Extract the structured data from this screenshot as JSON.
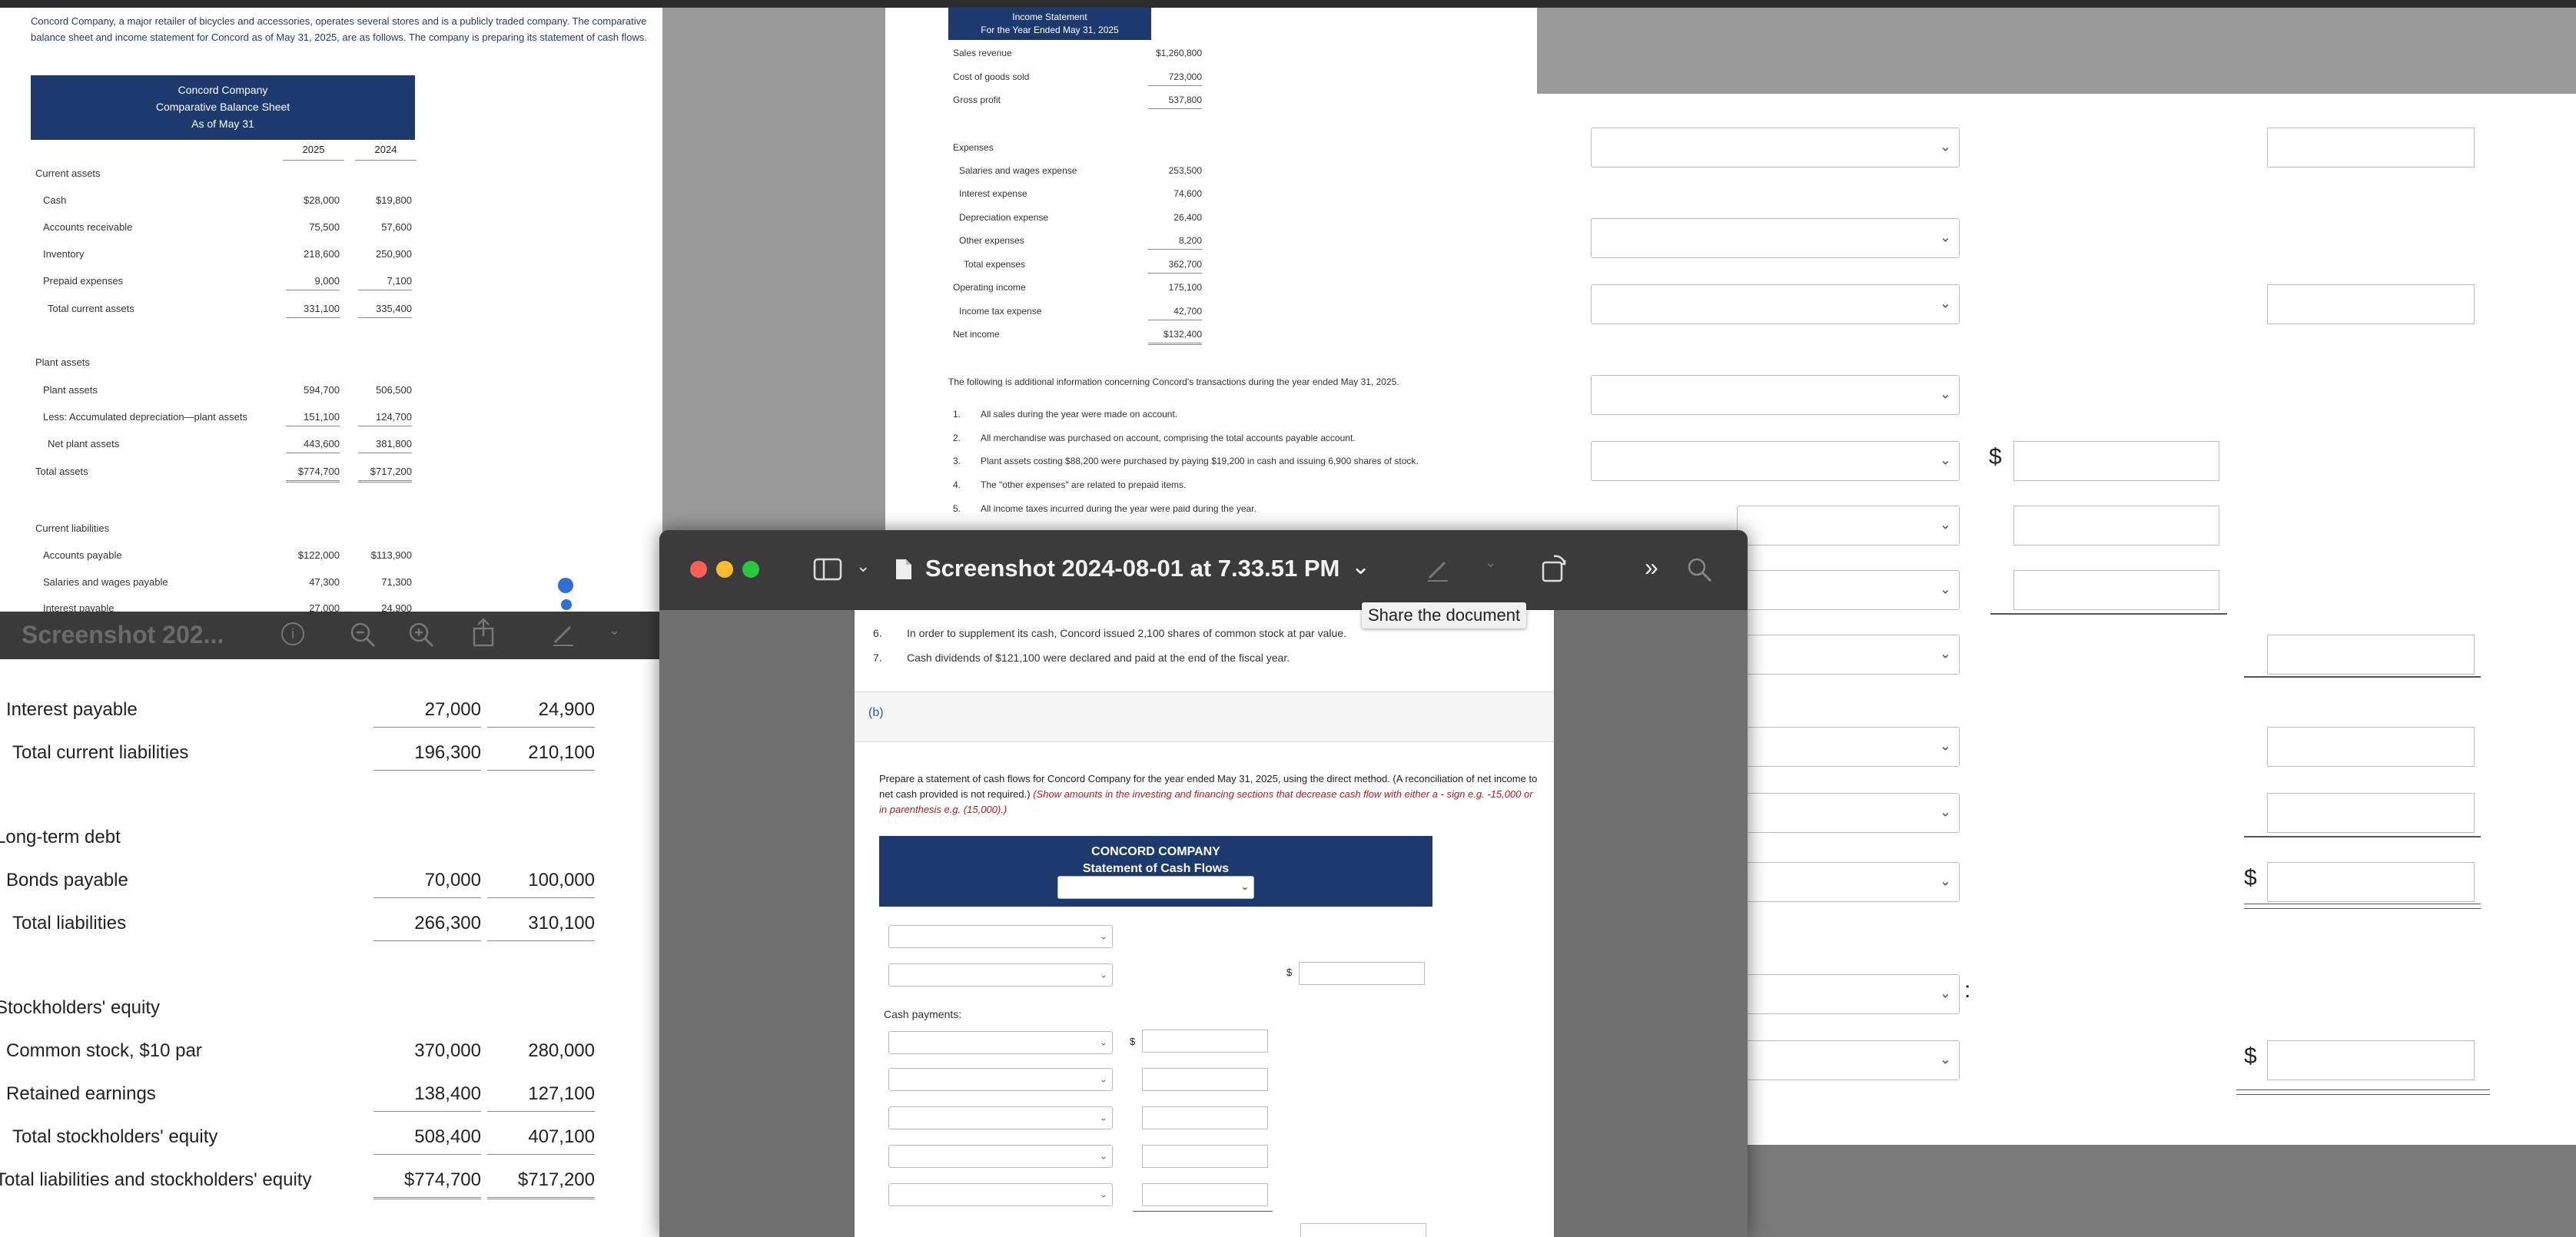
{
  "intro": "Concord Company, a major retailer of bicycles and accessories, operates several stores and is a publicly traded company. The comparative balance sheet and income statement for Concord as of May 31, 2025, are as follows. The company is preparing its statement of cash flows.",
  "balance_sheet": {
    "company": "Concord Company",
    "title": "Comparative Balance Sheet",
    "as_of": "As of May 31",
    "col1": "2025",
    "col2": "2024",
    "current_assets_label": "Current assets",
    "current_assets": [
      {
        "label": "Cash",
        "v1": "$28,000",
        "v2": "$19,800"
      },
      {
        "label": "Accounts receivable",
        "v1": "75,500",
        "v2": "57,600"
      },
      {
        "label": "Inventory",
        "v1": "218,600",
        "v2": "250,900"
      },
      {
        "label": "Prepaid expenses",
        "v1": "9,000",
        "v2": "7,100"
      },
      {
        "label": "Total current assets",
        "v1": "331,100",
        "v2": "335,400"
      }
    ],
    "plant_assets_label": "Plant assets",
    "plant_assets": [
      {
        "label": "Plant assets",
        "v1": "594,700",
        "v2": "506,500"
      },
      {
        "label": "Less: Accumulated depreciation—plant assets",
        "v1": "151,100",
        "v2": "124,700"
      },
      {
        "label": "Net plant assets",
        "v1": "443,600",
        "v2": "381,800"
      },
      {
        "label": "Total assets",
        "v1": "$774,700",
        "v2": "$717,200"
      }
    ],
    "current_liabilities_label": "Current liabilities",
    "current_liabilities": [
      {
        "label": "Accounts payable",
        "v1": "$122,000",
        "v2": "$113,900"
      },
      {
        "label": "Salaries and wages payable",
        "v1": "47,300",
        "v2": "71,300"
      },
      {
        "label": "Interest payable",
        "v1": "27,000",
        "v2": "24,900"
      }
    ]
  },
  "zoom_window": {
    "title": "Screenshot 202...",
    "rows": [
      {
        "label": "Interest payable",
        "v1": "27,000",
        "v2": "24,900"
      },
      {
        "label": "Total current liabilities",
        "v1": "196,300",
        "v2": "210,100"
      },
      {
        "label": "Long-term debt",
        "v1": "",
        "v2": ""
      },
      {
        "label": "Bonds payable",
        "v1": "70,000",
        "v2": "100,000"
      },
      {
        "label": "Total liabilities",
        "v1": "266,300",
        "v2": "310,100"
      },
      {
        "label": "Stockholders' equity",
        "v1": "",
        "v2": ""
      },
      {
        "label": "Common stock, $10 par",
        "v1": "370,000",
        "v2": "280,000"
      },
      {
        "label": "Retained earnings",
        "v1": "138,400",
        "v2": "127,100"
      },
      {
        "label": "Total stockholders' equity",
        "v1": "508,400",
        "v2": "407,100"
      },
      {
        "label": "Total liabilities and stockholders' equity",
        "v1": "$774,700",
        "v2": "$717,200"
      }
    ]
  },
  "income_statement": {
    "title": "Income Statement",
    "period": "For the Year Ended May 31, 2025",
    "rows": [
      {
        "label": "Sales revenue",
        "v": "$1,260,800"
      },
      {
        "label": "Cost of goods sold",
        "v": "723,000"
      },
      {
        "label": "Gross profit",
        "v": "537,800"
      },
      {
        "label": "Expenses",
        "v": ""
      },
      {
        "label": "Salaries and wages expense",
        "v": "253,500"
      },
      {
        "label": "Interest expense",
        "v": "74,600"
      },
      {
        "label": "Depreciation expense",
        "v": "26,400"
      },
      {
        "label": "Other expenses",
        "v": "8,200"
      },
      {
        "label": "Total expenses",
        "v": "362,700"
      },
      {
        "label": "Operating income",
        "v": "175,100"
      },
      {
        "label": "Income tax expense",
        "v": "42,700"
      },
      {
        "label": "Net income",
        "v": "$132,400"
      }
    ],
    "additional_intro": "The following is additional information concerning Concord's transactions during the year ended May 31, 2025.",
    "notes": [
      {
        "n": "1.",
        "t": "All sales during the year were made on account."
      },
      {
        "n": "2.",
        "t": "All merchandise was purchased on account, comprising the total accounts payable account."
      },
      {
        "n": "3.",
        "t": "Plant assets costing $88,200 were purchased by paying $19,200 in cash and issuing 6,900 shares of stock."
      },
      {
        "n": "4.",
        "t": "The \"other expenses\" are related to prepaid items."
      },
      {
        "n": "5.",
        "t": "All income taxes incurred during the year were paid during the year."
      }
    ]
  },
  "preview_window": {
    "title": "Screenshot 2024-08-01 at 7.33.51 PM",
    "tooltip": "Share the document",
    "notes": [
      {
        "n": "6.",
        "t": "In order to supplement its cash, Concord issued 2,100 shares of common stock at par value."
      },
      {
        "n": "7.",
        "t": "Cash dividends of $121,100 were declared and paid at the end of the fiscal year."
      }
    ],
    "part": "(b)",
    "instructions": "Prepare a statement of cash flows for Concord Company for the year ended May 31, 2025, using the direct method. (A reconciliation of net income to net cash provided is not required.)",
    "instructions_red": "(Show amounts in the investing and financing sections that decrease cash flow with either a - sign e.g. -15,000 or in parenthesis e.g. (15,000).)",
    "cf_company": "CONCORD COMPANY",
    "cf_title": "Statement of Cash Flows",
    "cash_payments_label": "Cash payments:",
    "dollar": "$"
  },
  "form": {
    "dollar": "$",
    "colon": ":"
  }
}
